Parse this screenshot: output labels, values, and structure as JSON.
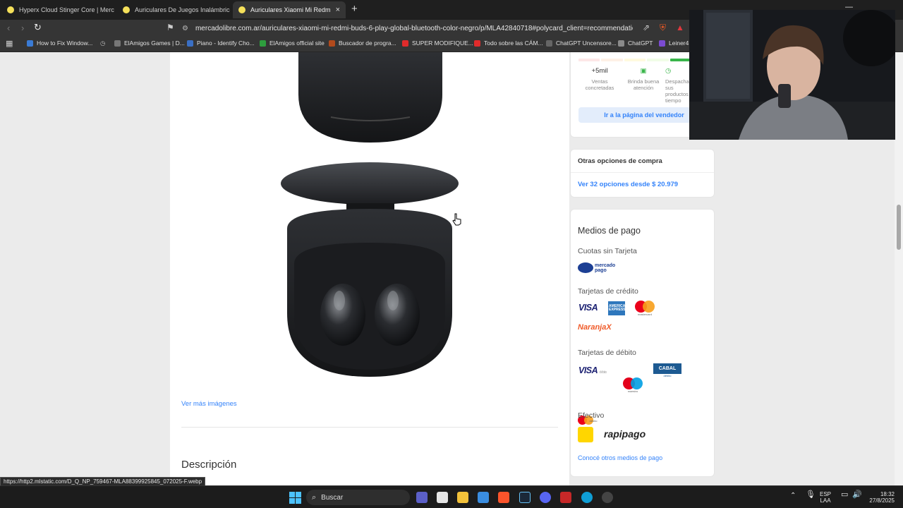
{
  "browser": {
    "tabs": [
      {
        "label": "Hyperx Cloud Stinger Core | Mercado",
        "active": false
      },
      {
        "label": "Auriculares De Juegos Inalámbricos",
        "active": false
      },
      {
        "label": "Auriculares Xiaomi Mi Redmi Bu",
        "active": true
      }
    ],
    "new_tab": "+",
    "close_glyph": "×",
    "url": "mercadolibre.com.ar/auriculares-xiaomi-mi-redmi-buds-6-play-global-bluetooth-color-negro/p/MLA42840718#polycard_client=recommendations_",
    "bookmarks": [
      {
        "label": "How to Fix Window...",
        "color": "#3a7bd5"
      },
      {
        "label": "ElAmigos Games | D...",
        "color": "#777777"
      },
      {
        "label": "Piano - Identify Cho...",
        "color": "#3a6fc4"
      },
      {
        "label": "ElAmigos official site",
        "color": "#2e9e3e"
      },
      {
        "label": "Buscador de progra...",
        "color": "#b24a1c"
      },
      {
        "label": "SUPER MODIFIQUE...",
        "color": "#e02b2b"
      },
      {
        "label": "Todo sobre las CÁM...",
        "color": "#e02b2b"
      },
      {
        "label": "ChatGPT Uncensore...",
        "color": "#666666"
      },
      {
        "label": "ChatGPT",
        "color": "#8a8a8a"
      },
      {
        "label": "Leiner4 -",
        "color": "#7b4bd1"
      }
    ],
    "status_url": "https://http2.mlstatic.com/D_Q_NP_759467-MLA88399925845_072025-F.webp"
  },
  "seller": {
    "stats": [
      {
        "value": "+5mil",
        "label": "Ventas concretadas"
      },
      {
        "value": "",
        "label": "Brinda buena atención"
      },
      {
        "value": "",
        "label": "Despacha sus productos a tiempo"
      }
    ],
    "vendor_button": "Ir a la página del vendedor"
  },
  "other_options": {
    "title": "Otras opciones de compra",
    "link": "Ver 32 opciones desde $ 20.979"
  },
  "payment": {
    "title": "Medios de pago",
    "cuotas_title": "Cuotas sin Tarjeta",
    "mercado_pago": "mercado pago",
    "credit_title": "Tarjetas de crédito",
    "visa": "VISA",
    "amex": "AMERICAN EXPRESS",
    "mastercard": "mastercard",
    "naranja": "NaranjaX",
    "debit_title": "Tarjetas de débito",
    "visa_debito": "débito",
    "maestro": "maestro",
    "cabal": "CABAL",
    "cabal_sub": "débito",
    "mc_debito": "débito",
    "cash_title": "Efectivo",
    "rapipago": "rapipago",
    "more_link": "Conocé otros medios de pago"
  },
  "product": {
    "ver_mas": "Ver más imágenes",
    "descripcion": "Descripción"
  },
  "taskbar": {
    "search_label": "Buscar",
    "lang_top": "ESP",
    "lang_bottom": "LAA",
    "time": "18:32",
    "date": "27/8/2025"
  },
  "colors": {
    "accent": "#3483fa",
    "reputation": [
      "#fde7e7",
      "#fef1e6",
      "#fffadf",
      "#f1fde7",
      "#39b54a"
    ]
  }
}
